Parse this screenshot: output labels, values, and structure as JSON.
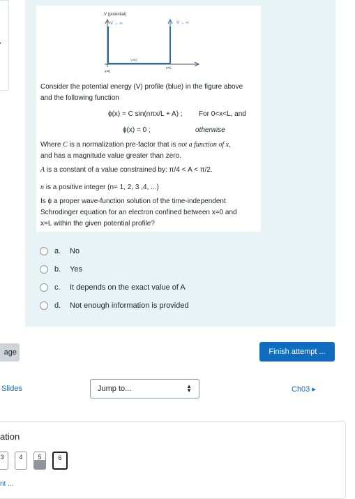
{
  "left_card": {
    "text": "f"
  },
  "figure": {
    "axis_label": "V (potential)",
    "v_inf_left": "V → ∞",
    "v_inf_right": "V → ∞",
    "v_zero": "V=0",
    "x0": "x=0",
    "xL": "x=L"
  },
  "question": {
    "intro": "Consider the potential energy (V) profile (blue) in the figure above",
    "intro2": "and the following function",
    "eq1": "ϕ(x) = C sin(nπx/L + A) ;",
    "eq1_cond": "For 0<x<L, and",
    "eq2": "ϕ(x) = 0 ;",
    "eq2_cond": "otherwise",
    "where1a": "Where ",
    "where1b": "C",
    "where1c": " is a normalization pre-factor that is ",
    "where1d": "not a function of x,",
    "where2": "and has a magnitude value greater than zero.",
    "aconst_a": "A",
    "aconst_b": " is a constant of a value constrained by: ",
    "aconst_c": "π/4 < A < π/2.",
    "n_a": "n",
    "n_b": " is a positive integer (n= 1, 2, 3 ,4, ...)",
    "ask1": "Is ϕ a proper wave-function solution of the time-independent",
    "ask2": "Schrodinger equation for an electron confined between x=0 and",
    "ask3": "x=L within the given potential profile?"
  },
  "answers": [
    {
      "letter": "a.",
      "text": "No"
    },
    {
      "letter": "b.",
      "text": "Yes"
    },
    {
      "letter": "c.",
      "text": "It depends on the exact value of A"
    },
    {
      "letter": "d.",
      "text": "Not enough information is provided"
    }
  ],
  "navigation": {
    "prev_page": "age",
    "finish_attempt": "Finish attempt ...",
    "slides": "Slides",
    "jump_to": "Jump to...",
    "next": "Ch03 ▸",
    "nav_title": "ation",
    "questions": [
      "3",
      "4",
      "5",
      "6"
    ],
    "finish_review": "nt ..."
  }
}
